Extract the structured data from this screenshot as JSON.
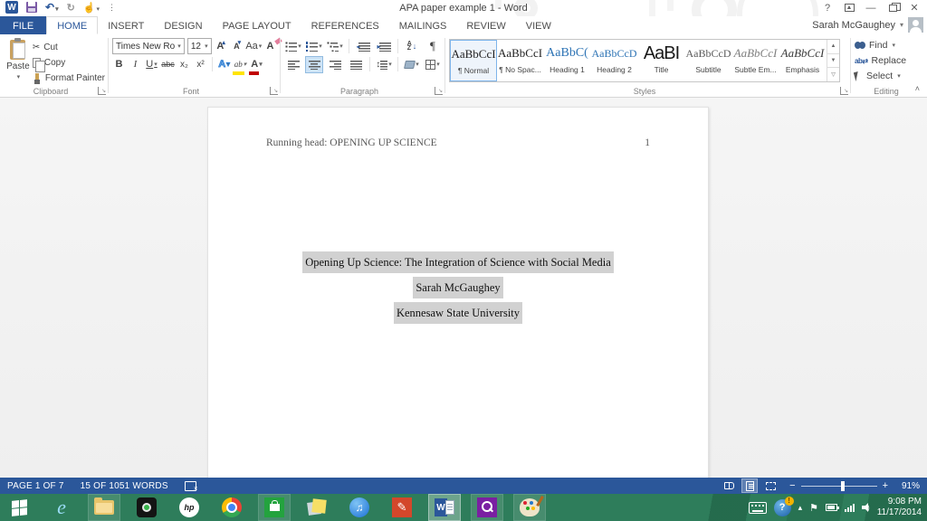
{
  "window": {
    "app_initial": "W",
    "title": "APA paper example 1 - Word",
    "help_label": "?",
    "user": "Sarah McGaughey"
  },
  "tabs": [
    "FILE",
    "HOME",
    "INSERT",
    "DESIGN",
    "PAGE LAYOUT",
    "REFERENCES",
    "MAILINGS",
    "REVIEW",
    "VIEW"
  ],
  "ribbon": {
    "clipboard": {
      "label": "Clipboard",
      "paste": "Paste",
      "cut": "Cut",
      "copy": "Copy",
      "format_painter": "Format Painter"
    },
    "font": {
      "label": "Font",
      "name": "Times New Ro",
      "size": "12",
      "grow": "A",
      "shrink": "A",
      "change_case": "Aa",
      "clear": "A",
      "bold": "B",
      "italic": "I",
      "underline": "U",
      "strikethrough": "abc",
      "subscript": "x₂",
      "superscript": "x²",
      "effects": "A",
      "highlight": "ab",
      "color": "A"
    },
    "paragraph": {
      "label": "Paragraph",
      "sort_a": "A",
      "sort_z": "Z",
      "pilcrow": "¶",
      "linespace_arrow": "↕"
    },
    "styles": {
      "label": "Styles",
      "items": [
        {
          "sample": "AaBbCcI",
          "name": "¶ Normal"
        },
        {
          "sample": "AaBbCcI",
          "name": "¶ No Spac..."
        },
        {
          "sample": "AaBbC(",
          "name": "Heading 1"
        },
        {
          "sample": "AaBbCcD",
          "name": "Heading 2"
        },
        {
          "sample": "AaBI",
          "name": "Title"
        },
        {
          "sample": "AaBbCcD",
          "name": "Subtitle"
        },
        {
          "sample": "AaBbCcI",
          "name": "Subtle Em..."
        },
        {
          "sample": "AaBbCcI",
          "name": "Emphasis"
        }
      ]
    },
    "editing": {
      "label": "Editing",
      "find": "Find",
      "replace": "Replace",
      "select": "Select",
      "replace_glyph": "ab\n*ac"
    }
  },
  "document": {
    "header_left": "Running head: OPENING UP SCIENCE",
    "page_number": "1",
    "lines": [
      "Opening Up Science: The Integration of Science with Social Media",
      "Sarah McGaughey",
      "Kennesaw State University"
    ]
  },
  "status": {
    "page": "PAGE 1 OF 7",
    "words": "15 OF 1051 WORDS",
    "zoom": "91%"
  },
  "taskbar": {
    "time": "9:08 PM",
    "date": "11/17/2014"
  }
}
